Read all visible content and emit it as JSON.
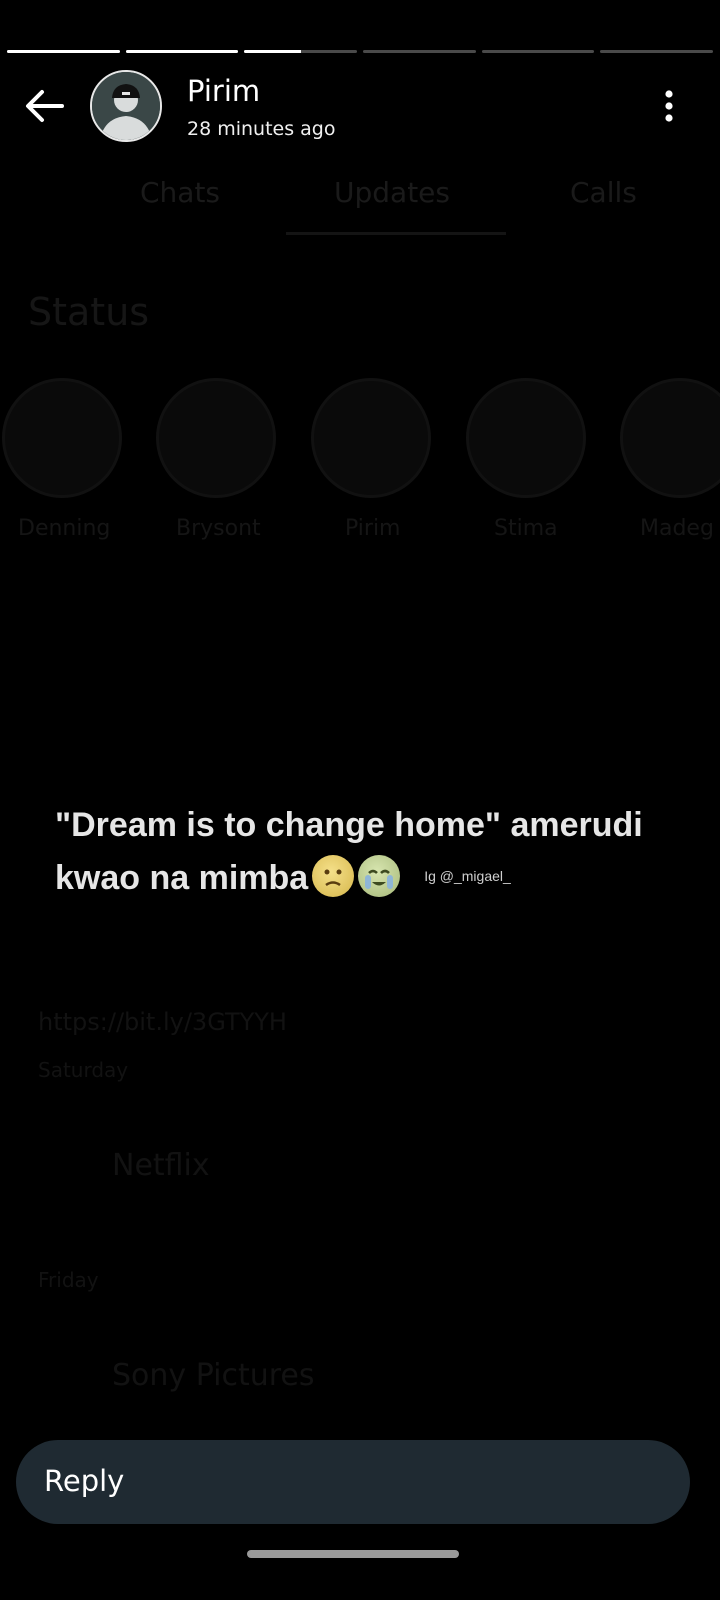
{
  "status": {
    "segments": [
      1,
      1,
      0.5,
      0,
      0,
      0
    ],
    "contact_name": "Pirim",
    "time_ago": "28 minutes ago",
    "caption_line1": "\"Dream is to change home\" amerudi",
    "caption_line2": "kwao na mimba",
    "watermark": "Ig @_migael_",
    "reply_label": "Reply"
  },
  "background": {
    "tabs": [
      "Chats",
      "Updates",
      "Calls"
    ],
    "section_title": "Status",
    "contacts": [
      "Denning",
      "Brysont",
      "Pirim",
      "Stima",
      "Madeg"
    ],
    "link_text": "https://bit.ly/3GTYYH",
    "link_day": "Saturday",
    "channel_1": "Netflix",
    "channel_1_day": "Friday",
    "channel_2": "Sony Pictures"
  },
  "colors": {
    "progress_active": "#ffffff",
    "progress_inactive": "#4a4a4a",
    "reply_bg": "#1f2a32"
  },
  "icons": {
    "back": "arrow-left-icon",
    "menu": "more-vert-icon",
    "emoji_1": "worried-face-emoji",
    "emoji_2": "crying-face-emoji"
  }
}
